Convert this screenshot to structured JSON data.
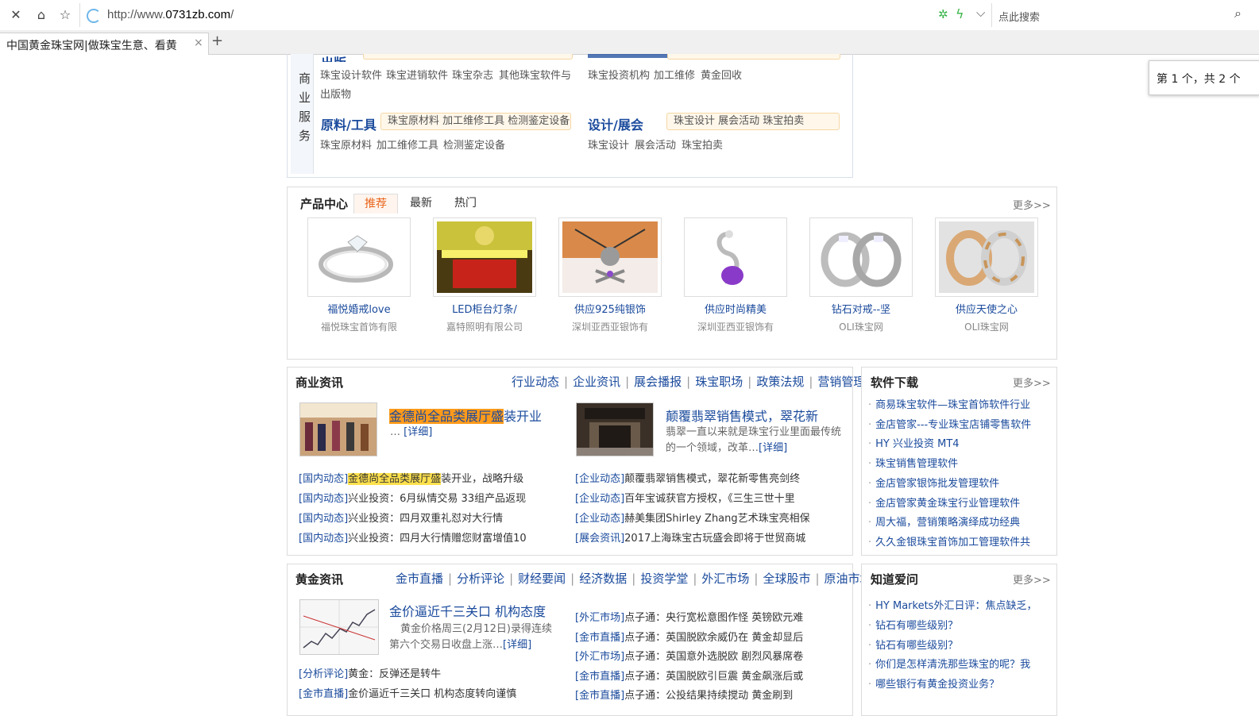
{
  "browser": {
    "url_prefix": "http://www.",
    "url_domain": "0731zb.com",
    "url_suffix": "/",
    "search_placeholder": "点此搜索",
    "tab_title": "中国黄金珠宝网|做珠宝生意、看黄",
    "find_status": "第 1 个，共 2 个"
  },
  "services": {
    "side_label": [
      "商",
      "业",
      "服",
      "务"
    ],
    "cut_title": "出版",
    "row1_left_subs": [
      "珠宝设计软件",
      "珠宝进销软件",
      "珠宝杂志",
      "其他珠宝软件与"
    ],
    "row1_left_wrap": "出版物",
    "row1_right_subs": [
      "珠宝投资机构",
      "加工维修",
      "黄金回收"
    ],
    "cat_materials": {
      "title": "原料/工具",
      "pill": "珠宝原材料  加工维修工具  检测鉴定设备",
      "subs": [
        "珠宝原材料",
        "加工维修工具",
        "检测鉴定设备"
      ]
    },
    "cat_design": {
      "title": "设计/展会",
      "pill": "珠宝设计  展会活动  珠宝拍卖",
      "subs": [
        "珠宝设计",
        "展会活动",
        "珠宝拍卖"
      ]
    }
  },
  "products": {
    "title": "产品中心",
    "tabs": [
      "推荐",
      "最新",
      "热门"
    ],
    "more": "更多>>",
    "items": [
      {
        "name": "福悦婚戒love",
        "company": "福悦珠宝首饰有限"
      },
      {
        "name": "LED柜台灯条/",
        "company": "嘉特照明有限公司"
      },
      {
        "name": "供应925纯银饰",
        "company": "深圳亚西亚银饰有"
      },
      {
        "name": "供应时尚精美",
        "company": "深圳亚西亚银饰有"
      },
      {
        "name": "钻石对戒--坚",
        "company": "OLI珠宝网"
      },
      {
        "name": "供应天使之心",
        "company": "OLI珠宝网"
      }
    ]
  },
  "biz_news": {
    "title": "商业资讯",
    "nav": [
      "行业动态",
      "企业资讯",
      "展会播报",
      "珠宝职场",
      "政策法规",
      "营销管理"
    ],
    "feature1": {
      "title_hl": "金德尚全品类展厅盛",
      "title_rest": "装开业",
      "summary": "… ",
      "detail": "[详细]"
    },
    "feature2": {
      "title": "颠覆翡翠销售模式，翠花新",
      "summary": "翡翠一直以来就是珠宝行业里面最传统的一个领域，改革…",
      "detail": "[详细]"
    },
    "left_list": [
      {
        "tag": "[国内动态]",
        "hl": "金德尚全品类展厅盛",
        "text": "装开业，战略升级"
      },
      {
        "tag": "[国内动态]",
        "hl": "",
        "text": "兴业投资：6月纵情交易 33组产品返现"
      },
      {
        "tag": "[国内动态]",
        "hl": "",
        "text": "兴业投资：四月双重礼怼对大行情"
      },
      {
        "tag": "[国内动态]",
        "hl": "",
        "text": "兴业投资：四月大行情赠您财富增值10"
      }
    ],
    "right_list": [
      {
        "tag": "[企业动态]",
        "text": "颠覆翡翠销售模式，翠花新零售亮剑终"
      },
      {
        "tag": "[企业动态]",
        "text": "百年宝诚获官方授权，《三生三世十里"
      },
      {
        "tag": "[企业动态]",
        "text": "赫美集团Shirley Zhang艺术珠宝亮相保"
      },
      {
        "tag": "[展会资讯]",
        "text": "2017上海珠宝古玩盛会即将于世贸商城"
      }
    ]
  },
  "software": {
    "title": "软件下载",
    "more": "更多>>",
    "items": [
      "商易珠宝软件—珠宝首饰软件行业",
      "金店管家---专业珠宝店铺零售软件",
      "HY 兴业投资 MT4",
      "珠宝销售管理软件",
      "金店管家银饰批发管理软件",
      "金店管家黄金珠宝行业管理软件",
      "周大福，营销策略演绎成功经典",
      "久久金银珠宝首饰加工管理软件共"
    ]
  },
  "gold_news": {
    "title": "黄金资讯",
    "nav": [
      "金市直播",
      "分析评论",
      "财经要闻",
      "经济数据",
      "投资学堂",
      "外汇市场",
      "全球股市",
      "原油市场"
    ],
    "feature": {
      "title": "金价逼近千三关口 机构态度",
      "summary": "黄金价格周三(2月12日)录得连续第六个交易日收盘上涨…",
      "detail": "[详细]"
    },
    "left_list": [
      {
        "tag": "[分析评论]",
        "text": "黄金：反弹还是转牛"
      },
      {
        "tag": "[金市直播]",
        "text": "金价逼近千三关口 机构态度转向谨慎"
      }
    ],
    "right_list": [
      {
        "tag": "[外汇市场]",
        "text": "点子通：央行宽松意图作怪 英镑欧元难"
      },
      {
        "tag": "[金市直播]",
        "text": "点子通：英国脱欧余威仍在 黄金却显后"
      },
      {
        "tag": "[外汇市场]",
        "text": "点子通：英国意外选脱欧 剧烈风暴席卷"
      },
      {
        "tag": "[金市直播]",
        "text": "点子通：英国脱欧引巨震 黄金飙涨后或"
      },
      {
        "tag": "[金市直播]",
        "text": "点子通：公投结果持续搅动 黄金刷到"
      }
    ]
  },
  "qa": {
    "title": "知道爱问",
    "more": "更多>>",
    "items": [
      "HY Markets外汇日评：焦点缺乏，",
      "钻石有哪些级别？",
      "钻石有哪些级别？",
      "你们是怎样清洗那些珠宝的呢？我",
      "哪些银行有黄金投资业务？"
    ]
  },
  "colors": {
    "link_blue": "#1a4a9c",
    "highlight_yellow": "#ffe14d",
    "highlight_orange": "#ff9a1a",
    "tab_active": "#e8641b"
  }
}
